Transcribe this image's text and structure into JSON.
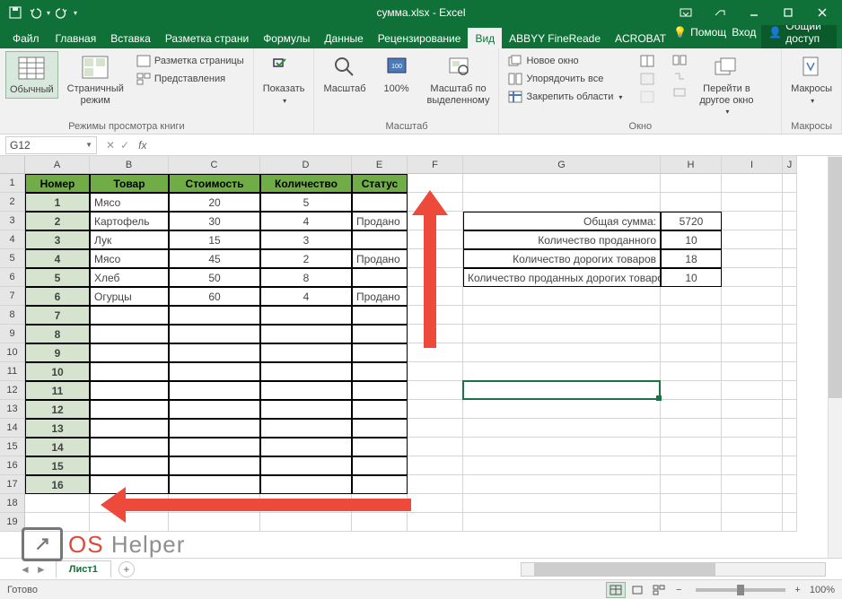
{
  "app": {
    "title": "сумма.xlsx - Excel"
  },
  "qat": {
    "save": "save",
    "undo": "undo",
    "redo": "redo"
  },
  "tabs": {
    "file": "Файл",
    "home": "Главная",
    "insert": "Вставка",
    "layout": "Разметка страни",
    "formulas": "Формулы",
    "data": "Данные",
    "review": "Рецензирование",
    "view": "Вид",
    "abbyy": "ABBYY FineReade",
    "acrobat": "ACROBAT",
    "help": "Помощ",
    "signin": "Вход",
    "share": "Общий доступ"
  },
  "ribbon": {
    "group_views": "Режимы просмотра книги",
    "normal": "Обычный",
    "pagebreak": "Страничный\nрежим",
    "page_layout": "Разметка страницы",
    "custom_views": "Представления",
    "group_show": "Показать",
    "show": "Показать",
    "group_zoom": "Масштаб",
    "zoom": "Масштаб",
    "zoom100": "100%",
    "zoom_sel": "Масштаб по\nвыделенному",
    "group_window": "Окно",
    "new_win": "Новое окно",
    "arrange": "Упорядочить все",
    "freeze": "Закрепить области",
    "switch": "Перейти в\nдругое окно",
    "group_macros": "Макросы",
    "macros": "Макросы"
  },
  "namebox": "G12",
  "cols": {
    "A": 72,
    "B": 88,
    "C": 102,
    "D": 102,
    "E": 62,
    "F": 62,
    "G": 220,
    "H": 68,
    "I": 68,
    "J": 16
  },
  "header_row": {
    "A": "Номер",
    "B": "Товар",
    "C": "Стоимость",
    "D": "Количество",
    "E": "Статус"
  },
  "data_rows": [
    {
      "n": "1",
      "t": "Мясо",
      "c": "20",
      "q": "5",
      "s": ""
    },
    {
      "n": "2",
      "t": "Картофель",
      "c": "30",
      "q": "4",
      "s": "Продано"
    },
    {
      "n": "3",
      "t": "Лук",
      "c": "15",
      "q": "3",
      "s": ""
    },
    {
      "n": "4",
      "t": "Мясо",
      "c": "45",
      "q": "2",
      "s": "Продано"
    },
    {
      "n": "5",
      "t": "Хлеб",
      "c": "50",
      "q": "8",
      "s": ""
    },
    {
      "n": "6",
      "t": "Огурцы",
      "c": "60",
      "q": "4",
      "s": "Продано"
    }
  ],
  "num_continue": [
    "7",
    "8",
    "9",
    "10",
    "11",
    "12",
    "13",
    "14",
    "15",
    "16"
  ],
  "summary": [
    {
      "label": "Общая сумма:",
      "val": "5720"
    },
    {
      "label": "Количество проданного",
      "val": "10"
    },
    {
      "label": "Количество дорогих товаров",
      "val": "18"
    },
    {
      "label": "Количество проданных дорогих товаров",
      "val": "10"
    }
  ],
  "sheet": "Лист1",
  "status": "Готово",
  "zoom": "100%"
}
